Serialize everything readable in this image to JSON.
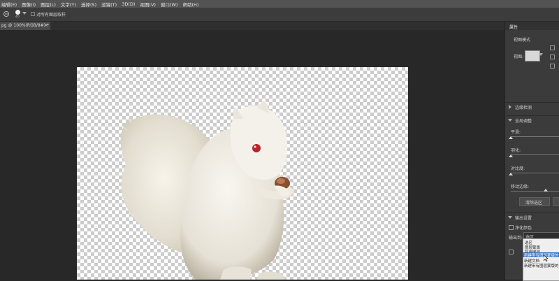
{
  "menu": [
    "编辑(E)",
    "图像(I)",
    "图层(L)",
    "文字(Y)",
    "选择(S)",
    "滤镜(T)",
    "3D(D)",
    "视图(V)",
    "窗口(W)",
    "帮助(H)"
  ],
  "options": {
    "brush_size": "40",
    "sample_all_layers": "对所有图层取样"
  },
  "document_tab": "pg @ 100%(RGB/8#) *",
  "panel": {
    "tab": "属性",
    "view_mode": "视图模式",
    "view_label": "视图:",
    "edge_detection": "边缘检测",
    "global_refine": "全局调整",
    "smooth": "平滑:",
    "feather": "羽化:",
    "contrast": "对比度:",
    "shift_edge": "移动边缘:",
    "clear_selection": "清除选区",
    "output_settings": "输出设置",
    "decontaminate": "净化颜色",
    "output_to": "输出到:",
    "output_value": "选区",
    "dropdown_items": [
      "选区",
      "图层蒙版",
      "新建图层",
      "新建带有图层蒙版的",
      "新建文档",
      "新建带有图层蒙版的"
    ]
  },
  "colors": {
    "accent": "#3a74c4",
    "fur": "#ece8de"
  }
}
